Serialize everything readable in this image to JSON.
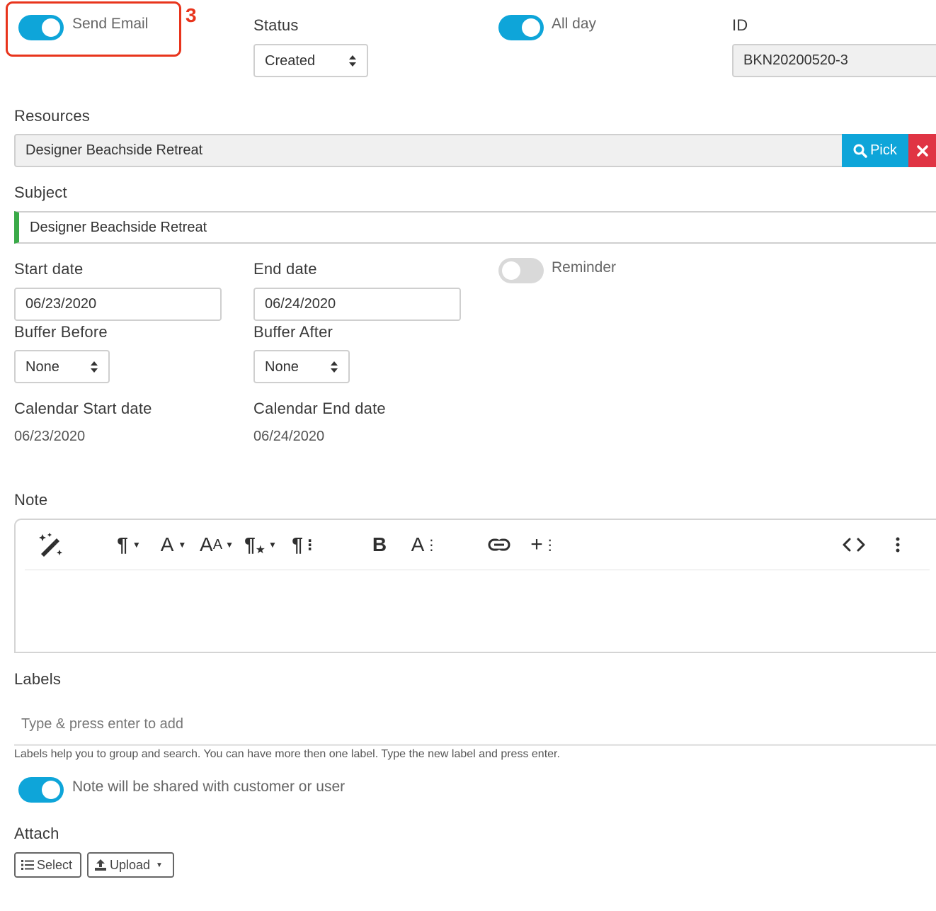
{
  "annotation": {
    "marker": "3",
    "color": "#e8341c"
  },
  "send_email": {
    "label": "Send Email",
    "on": true
  },
  "status": {
    "label": "Status",
    "value": "Created"
  },
  "all_day": {
    "label": "All day",
    "on": true
  },
  "id_field": {
    "label": "ID",
    "value": "BKN20200520-3"
  },
  "resources": {
    "label": "Resources",
    "value": "Designer Beachside Retreat",
    "pick_label": "Pick"
  },
  "subject": {
    "label": "Subject",
    "value": "Designer Beachside Retreat"
  },
  "start_date": {
    "label": "Start date",
    "value": "06/23/2020"
  },
  "end_date": {
    "label": "End date",
    "value": "06/24/2020"
  },
  "reminder": {
    "label": "Reminder",
    "on": false
  },
  "buffer_before": {
    "label": "Buffer Before",
    "value": "None"
  },
  "buffer_after": {
    "label": "Buffer After",
    "value": "None"
  },
  "calendar_start": {
    "label": "Calendar Start date",
    "value": "06/23/2020"
  },
  "calendar_end": {
    "label": "Calendar End date",
    "value": "06/24/2020"
  },
  "note": {
    "label": "Note",
    "toolbar": [
      "magic-wand-icon",
      "paragraph-format-icon",
      "font-family-icon",
      "font-size-icon",
      "paragraph-style-icon",
      "more-paragraph-icon",
      "bold-icon",
      "more-text-icon",
      "link-icon",
      "more-insert-icon",
      "code-view-icon",
      "more-misc-icon"
    ]
  },
  "labels": {
    "label": "Labels",
    "placeholder": "Type & press enter to add",
    "help": "Labels help you to group and search. You can have more then one label. Type the new label and press enter."
  },
  "share_note": {
    "label": "Note will be shared with customer or user",
    "on": true
  },
  "attach": {
    "label": "Attach",
    "select_label": "Select",
    "upload_label": "Upload"
  },
  "colors": {
    "accent": "#0ea5d9",
    "danger": "#e03444",
    "subject_bar": "#3aaa48",
    "toggle_off": "#d9d9d9"
  }
}
